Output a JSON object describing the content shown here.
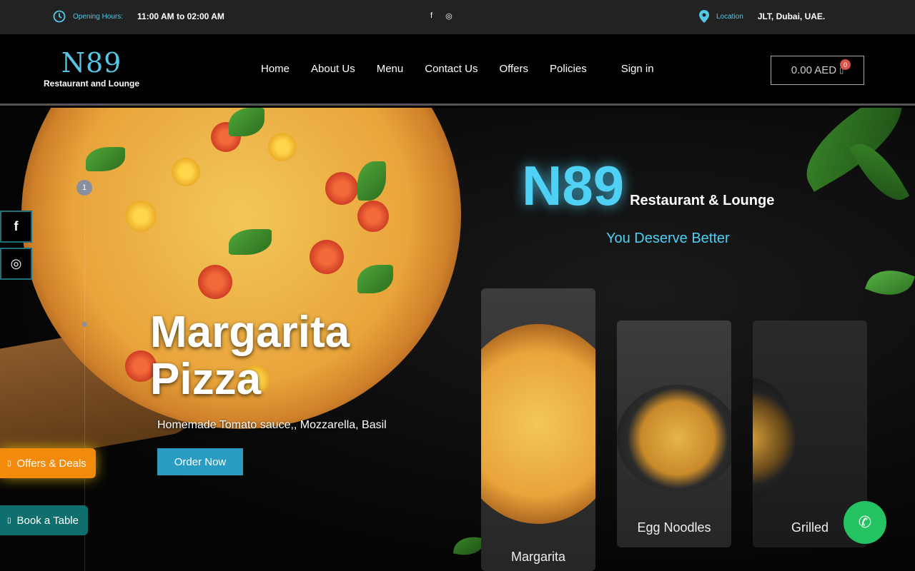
{
  "topbar": {
    "hours_label": "Opening Hours:",
    "hours_value": "11:00 AM to 02:00 AM",
    "social": [
      "f",
      "◎"
    ],
    "location_label": "Location",
    "location_value": "JLT, Dubai, UAE."
  },
  "header": {
    "logo_mark": "N89",
    "logo_sub": "Restaurant and Lounge",
    "nav": [
      "Home",
      "About Us",
      "Menu",
      "Contact Us",
      "Offers",
      "Policies"
    ],
    "signin": "Sign in",
    "cart_total": "0.00 AED",
    "cart_count": "0"
  },
  "hero": {
    "slide_number": "1",
    "title": "Margarita Pizza",
    "description": "Homemade Tomato sauce,, Mozzarella, Basil",
    "order_button": "Order Now",
    "brand_big": "N89",
    "brand_rest": "Restaurant & Lounge",
    "tagline": "You Deserve Better"
  },
  "cards": [
    {
      "name": "Margarita"
    },
    {
      "name": "Egg Noodles"
    },
    {
      "name": "Grilled"
    }
  ],
  "floating": {
    "facebook": "f",
    "instagram": "◎",
    "offers": "Offers & Deals",
    "book": "Book a Table",
    "whatsapp": "✆"
  },
  "colors": {
    "accent": "#4fd0f5",
    "order_button": "#2a9bc2",
    "offers": "#f28b0c",
    "book": "#0f6f6f",
    "whatsapp": "#25c262"
  }
}
